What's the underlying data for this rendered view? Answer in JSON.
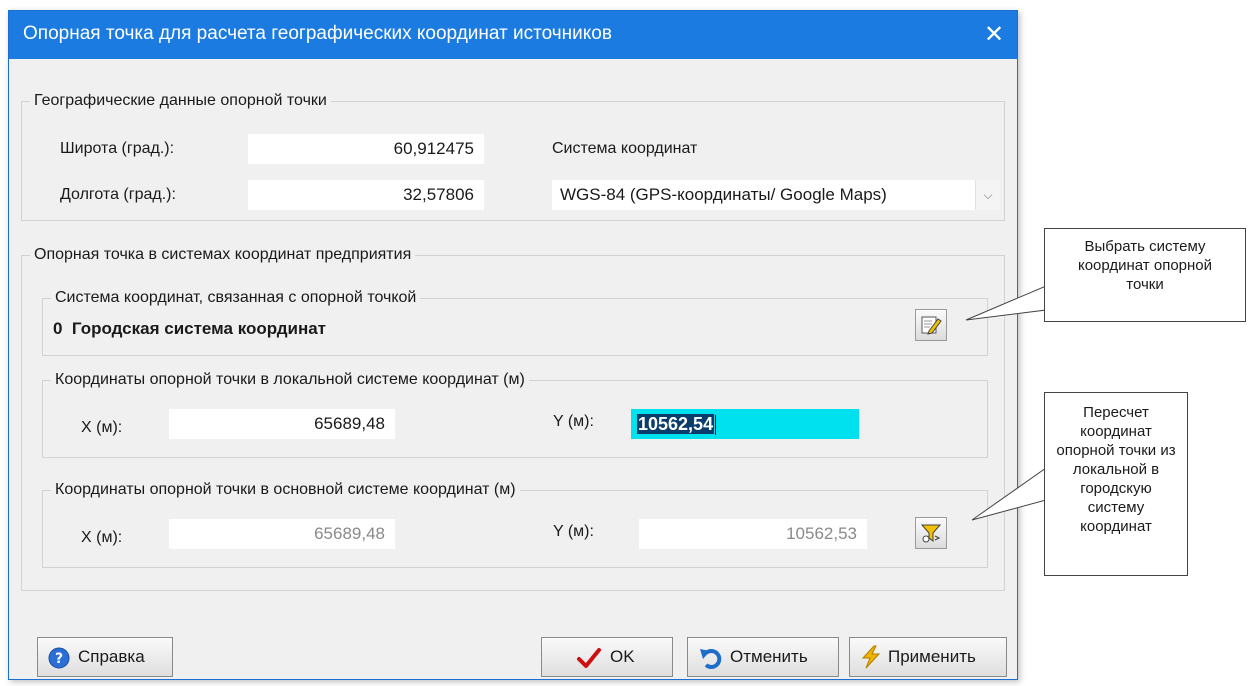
{
  "dialog": {
    "title": "Опорная точка для расчета географических координат источников",
    "close_glyph": "✕"
  },
  "geo_group": {
    "legend": "Географические данные опорной точки",
    "lat_label": "Широта (град.):",
    "lat_value": "60,912475",
    "lon_label": "Долгота (град.):",
    "lon_value": "32,57806",
    "crs_label": "Система координат",
    "crs_selected": "WGS-84 (GPS-координаты/ Google Maps)"
  },
  "enterprise_group": {
    "legend": "Опорная точка в системах координат предприятия",
    "linked": {
      "legend": "Система координат, связанная с опорной точкой",
      "value": "0  Городская система координат"
    },
    "local": {
      "legend": "Координаты опорной точки в локальной системе координат (м)",
      "x_label": "X (м):",
      "x_value": "65689,48",
      "y_label": "Y (м):",
      "y_value": "10562,54"
    },
    "main": {
      "legend": "Координаты опорной точки в основной системе координат (м)",
      "x_label": "X (м):",
      "x_value": "65689,48",
      "y_label": "Y (м):",
      "y_value": "10562,53"
    }
  },
  "buttons": {
    "help": "Справка",
    "ok": "OK",
    "cancel": "Отменить",
    "apply": "Применить"
  },
  "callouts": {
    "select_crs": "Выбрать систему координат опорной точки",
    "recalc": "Пересчет координат опорной точки из локальной в городскую систему координат"
  },
  "colors": {
    "titlebar": "#1b7be0",
    "active_field": "#00e1f0",
    "ok_check": "#cc1010",
    "help_icon": "#2a6fd6",
    "cancel_icon": "#1e6ec8",
    "apply_icon": "#f2b400"
  }
}
